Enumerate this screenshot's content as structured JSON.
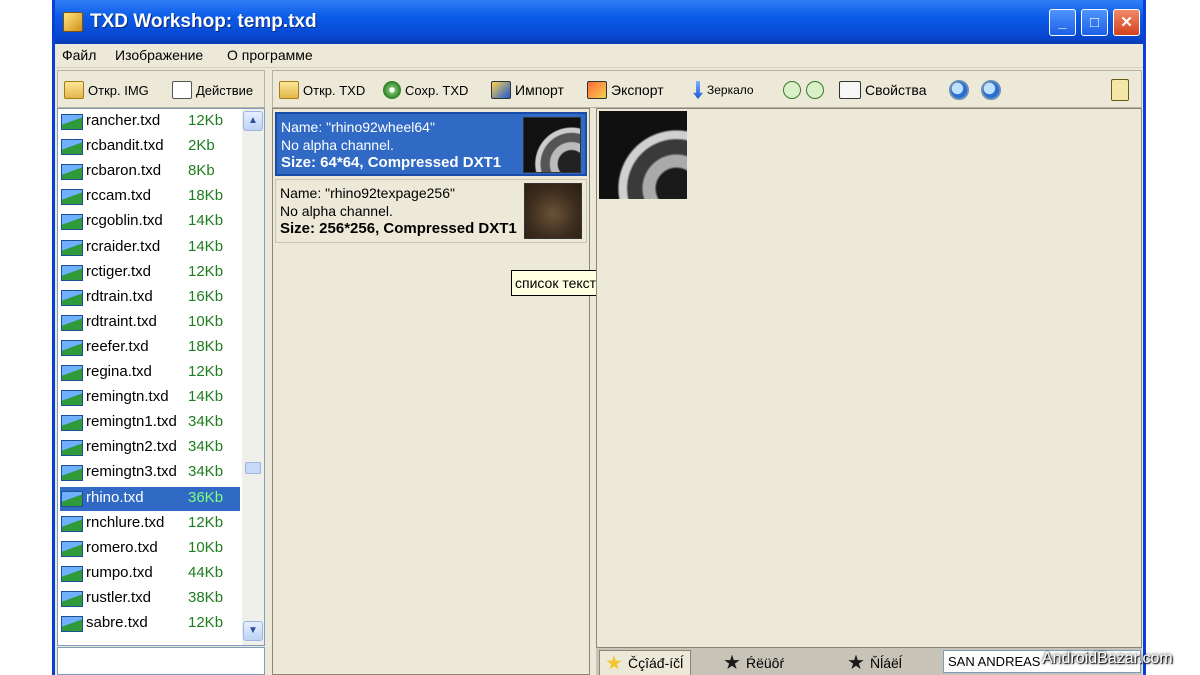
{
  "window": {
    "title": "TXD Workshop: temp.txd"
  },
  "menu": [
    "Файл",
    "Изображение",
    "О программе"
  ],
  "left_toolbar": [
    {
      "label": "Откр. IMG",
      "icon": "folder-icon"
    },
    {
      "label": "Действие",
      "icon": "action-icon"
    }
  ],
  "main_toolbar": [
    {
      "label": "Откр. TXD",
      "icon": "folder-icon"
    },
    {
      "label": "Сохр. TXD",
      "icon": "disc-icon"
    },
    {
      "label": "Импорт",
      "icon": "import-icon"
    },
    {
      "label": "Экспорт",
      "icon": "export-icon"
    },
    {
      "label": "Зеркало",
      "icon": "mirror-arrow-icon"
    }
  ],
  "properties_label": "Свойства",
  "files": [
    {
      "name": "rancher.txd",
      "size": "12Kb"
    },
    {
      "name": "rcbandit.txd",
      "size": "2Kb"
    },
    {
      "name": "rcbaron.txd",
      "size": "8Kb"
    },
    {
      "name": "rccam.txd",
      "size": "18Kb"
    },
    {
      "name": "rcgoblin.txd",
      "size": "14Kb"
    },
    {
      "name": "rcraider.txd",
      "size": "14Kb"
    },
    {
      "name": "rctiger.txd",
      "size": "12Kb"
    },
    {
      "name": "rdtrain.txd",
      "size": "16Kb"
    },
    {
      "name": "rdtraint.txd",
      "size": "10Kb"
    },
    {
      "name": "reefer.txd",
      "size": "18Kb"
    },
    {
      "name": "regina.txd",
      "size": "12Kb"
    },
    {
      "name": "remingtn.txd",
      "size": "14Kb"
    },
    {
      "name": "remingtn1.txd",
      "size": "34Kb"
    },
    {
      "name": "remingtn2.txd",
      "size": "34Kb"
    },
    {
      "name": "remingtn3.txd",
      "size": "34Kb"
    },
    {
      "name": "rhino.txd",
      "size": "36Kb"
    },
    {
      "name": "rnchlure.txd",
      "size": "12Kb"
    },
    {
      "name": "romero.txd",
      "size": "10Kb"
    },
    {
      "name": "rumpo.txd",
      "size": "44Kb"
    },
    {
      "name": "rustler.txd",
      "size": "38Kb"
    },
    {
      "name": "sabre.txd",
      "size": "12Kb"
    }
  ],
  "selected_file": "rhino.txd",
  "textures": [
    {
      "name": "Name: \"rhino92wheel64\"",
      "alpha": "No alpha channel.",
      "size": "Size: 64*64, Compressed DXT1",
      "selected": true
    },
    {
      "name": "Name: \"rhino92texpage256\"",
      "alpha": "No alpha channel.",
      "size": "Size: 256*256, Compressed DXT1",
      "selected": false
    }
  ],
  "tooltip": "список текстур",
  "tabs": [
    {
      "label": "Čçîáđ-íčĺ",
      "active": true
    },
    {
      "label": "Ŕëüôŕ",
      "active": false
    },
    {
      "label": "Ňĺáëĺ",
      "active": false
    }
  ],
  "game_select": "SAN ANDREAS",
  "watermark": "AndroidBazar.com"
}
